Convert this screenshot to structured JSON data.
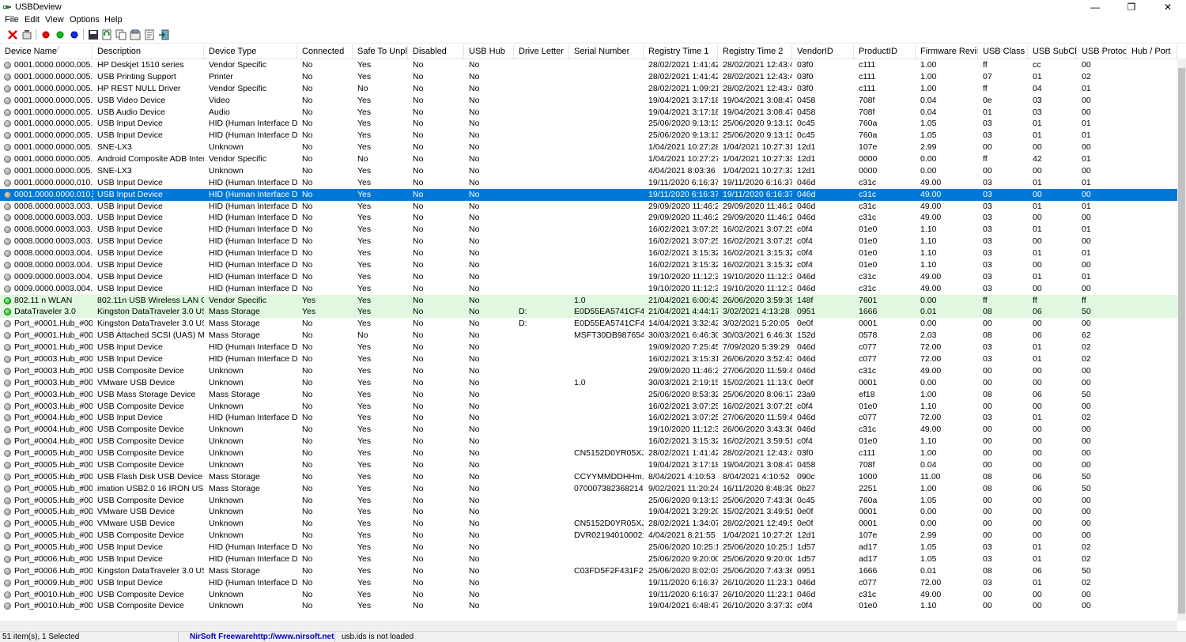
{
  "window": {
    "title": "USBDeview",
    "minimize": "—",
    "restore": "❐",
    "close": "✕"
  },
  "menu": [
    "File",
    "Edit",
    "View",
    "Options",
    "Help"
  ],
  "columns": [
    "Device Name",
    "Description",
    "Device Type",
    "Connected",
    "Safe To Unpl...",
    "Disabled",
    "USB Hub",
    "Drive Letter",
    "Serial Number",
    "Registry Time 1",
    "Registry Time 2",
    "VendorID",
    "ProductID",
    "Firmware Revis...",
    "USB Class",
    "USB SubCl...",
    "USB Protoc...",
    "Hub / Port"
  ],
  "rows": [
    {
      "status": "grey",
      "c": [
        "0001.0000.0000.005.00...",
        "HP Deskjet 1510 series",
        "Vendor Specific",
        "No",
        "Yes",
        "No",
        "No",
        "",
        "",
        "28/02/2021 1:41:42...",
        "28/02/2021 12:43:4...",
        "03f0",
        "c111",
        "1.00",
        "ff",
        "cc",
        "00",
        ""
      ]
    },
    {
      "status": "grey",
      "c": [
        "0001.0000.0000.005.00...",
        "USB Printing Support",
        "Printer",
        "No",
        "Yes",
        "No",
        "No",
        "",
        "",
        "28/02/2021 1:41:42...",
        "28/02/2021 12:43:4...",
        "03f0",
        "c111",
        "1.00",
        "07",
        "01",
        "02",
        ""
      ]
    },
    {
      "status": "grey",
      "c": [
        "0001.0000.0000.005.00...",
        "HP REST NULL Driver",
        "Vendor Specific",
        "No",
        "No",
        "No",
        "No",
        "",
        "",
        "28/02/2021 1:09:21...",
        "28/02/2021 12:43:4...",
        "03f0",
        "c111",
        "1.00",
        "ff",
        "04",
        "01",
        ""
      ]
    },
    {
      "status": "grey",
      "c": [
        "0001.0000.0000.005.00...",
        "USB Video Device",
        "Video",
        "No",
        "Yes",
        "No",
        "No",
        "",
        "",
        "19/04/2021 3:17:18...",
        "19/04/2021 3:08:47...",
        "0458",
        "708f",
        "0.04",
        "0e",
        "03",
        "00",
        ""
      ]
    },
    {
      "status": "grey",
      "c": [
        "0001.0000.0000.005.00...",
        "USB Audio Device",
        "Audio",
        "No",
        "Yes",
        "No",
        "No",
        "",
        "",
        "19/04/2021 3:17:18...",
        "19/04/2021 3:08:47...",
        "0458",
        "708f",
        "0.04",
        "01",
        "03",
        "00",
        ""
      ]
    },
    {
      "status": "grey",
      "c": [
        "0001.0000.0000.005.00...",
        "USB Input Device",
        "HID (Human Interface D...",
        "No",
        "Yes",
        "No",
        "No",
        "",
        "",
        "25/06/2020 9:13:13...",
        "25/06/2020 9:13:13...",
        "0c45",
        "760a",
        "1.05",
        "03",
        "01",
        "01",
        ""
      ]
    },
    {
      "status": "grey",
      "c": [
        "0001.0000.0000.005.00...",
        "USB Input Device",
        "HID (Human Interface D...",
        "No",
        "Yes",
        "No",
        "No",
        "",
        "",
        "25/06/2020 9:13:13...",
        "25/06/2020 9:13:13...",
        "0c45",
        "760a",
        "1.05",
        "03",
        "01",
        "01",
        ""
      ]
    },
    {
      "status": "grey",
      "c": [
        "0001.0000.0000.005.00...",
        "SNE-LX3",
        "Unknown",
        "No",
        "Yes",
        "No",
        "No",
        "",
        "",
        "1/04/2021 10:27:28...",
        "1/04/2021 10:27:31...",
        "12d1",
        "107e",
        "2.99",
        "00",
        "00",
        "00",
        ""
      ]
    },
    {
      "status": "grey",
      "c": [
        "0001.0000.0000.005.00...",
        "Android Composite ADB Inter...",
        "Vendor Specific",
        "No",
        "No",
        "No",
        "No",
        "",
        "",
        "1/04/2021 10:27:27...",
        "1/04/2021 10:27:33...",
        "12d1",
        "0000",
        "0.00",
        "ff",
        "42",
        "01",
        ""
      ]
    },
    {
      "status": "grey",
      "c": [
        "0001.0000.0000.005.00...",
        "SNE-LX3",
        "Unknown",
        "No",
        "Yes",
        "No",
        "No",
        "",
        "",
        "4/04/2021 8:03:36 ...",
        "1/04/2021 10:27:33...",
        "12d1",
        "0000",
        "0.00",
        "00",
        "00",
        "00",
        ""
      ]
    },
    {
      "status": "grey",
      "c": [
        "0001.0000.0000.010.00...",
        "USB Input Device",
        "HID (Human Interface D...",
        "No",
        "Yes",
        "No",
        "No",
        "",
        "",
        "19/11/2020 6:16:37...",
        "19/11/2020 6:16:37...",
        "046d",
        "c31c",
        "49.00",
        "03",
        "01",
        "01",
        ""
      ]
    },
    {
      "status": "grey",
      "selected": true,
      "c": [
        "0001.0000.0000.010.00...",
        "USB Input Device",
        "HID (Human Interface D...",
        "No",
        "Yes",
        "No",
        "No",
        "",
        "",
        "19/11/2020 6:16:37...",
        "19/11/2020 6:16:37...",
        "046d",
        "c31c",
        "49.00",
        "03",
        "00",
        "00",
        ""
      ]
    },
    {
      "status": "grey",
      "c": [
        "0008.0000.0003.003.00...",
        "USB Input Device",
        "HID (Human Interface D...",
        "No",
        "Yes",
        "No",
        "No",
        "",
        "",
        "29/09/2020 11:46:2...",
        "29/09/2020 11:46:2...",
        "046d",
        "c31c",
        "49.00",
        "03",
        "01",
        "01",
        ""
      ]
    },
    {
      "status": "grey",
      "c": [
        "0008.0000.0003.003.00...",
        "USB Input Device",
        "HID (Human Interface D...",
        "No",
        "Yes",
        "No",
        "No",
        "",
        "",
        "29/09/2020 11:46:2...",
        "29/09/2020 11:46:2...",
        "046d",
        "c31c",
        "49.00",
        "03",
        "00",
        "00",
        ""
      ]
    },
    {
      "status": "grey",
      "c": [
        "0008.0000.0003.003.00...",
        "USB Input Device",
        "HID (Human Interface D...",
        "No",
        "Yes",
        "No",
        "No",
        "",
        "",
        "16/02/2021 3:07:25...",
        "16/02/2021 3:07:25...",
        "c0f4",
        "01e0",
        "1.10",
        "03",
        "01",
        "01",
        ""
      ]
    },
    {
      "status": "grey",
      "c": [
        "0008.0000.0003.003.00...",
        "USB Input Device",
        "HID (Human Interface D...",
        "No",
        "Yes",
        "No",
        "No",
        "",
        "",
        "16/02/2021 3:07:25...",
        "16/02/2021 3:07:25...",
        "c0f4",
        "01e0",
        "1.10",
        "03",
        "00",
        "00",
        ""
      ]
    },
    {
      "status": "grey",
      "c": [
        "0008.0000.0003.004.00...",
        "USB Input Device",
        "HID (Human Interface D...",
        "No",
        "Yes",
        "No",
        "No",
        "",
        "",
        "16/02/2021 3:15:32...",
        "16/02/2021 3:15:32...",
        "c0f4",
        "01e0",
        "1.10",
        "03",
        "01",
        "01",
        ""
      ]
    },
    {
      "status": "grey",
      "c": [
        "0008.0000.0003.004.00...",
        "USB Input Device",
        "HID (Human Interface D...",
        "No",
        "Yes",
        "No",
        "No",
        "",
        "",
        "16/02/2021 3:15:32...",
        "16/02/2021 3:15:32...",
        "c0f4",
        "01e0",
        "1.10",
        "03",
        "00",
        "00",
        ""
      ]
    },
    {
      "status": "grey",
      "c": [
        "0009.0000.0003.004.00...",
        "USB Input Device",
        "HID (Human Interface D...",
        "No",
        "Yes",
        "No",
        "No",
        "",
        "",
        "19/10/2020 11:12:3...",
        "19/10/2020 11:12:3...",
        "046d",
        "c31c",
        "49.00",
        "03",
        "01",
        "01",
        ""
      ]
    },
    {
      "status": "grey",
      "c": [
        "0009.0000.0003.004.00...",
        "USB Input Device",
        "HID (Human Interface D...",
        "No",
        "Yes",
        "No",
        "No",
        "",
        "",
        "19/10/2020 11:12:3...",
        "19/10/2020 11:12:3...",
        "046d",
        "c31c",
        "49.00",
        "03",
        "00",
        "00",
        ""
      ]
    },
    {
      "status": "green",
      "green": true,
      "c": [
        "802.11 n WLAN",
        "802.11n USB Wireless LAN Card",
        "Vendor Specific",
        "Yes",
        "Yes",
        "No",
        "No",
        "",
        "1.0",
        "21/04/2021 6:00:43...",
        "26/06/2020 3:59:39...",
        "148f",
        "7601",
        "0.00",
        "ff",
        "ff",
        "ff",
        ""
      ]
    },
    {
      "status": "green",
      "green": true,
      "c": [
        "DataTraveler 3.0",
        "Kingston DataTraveler 3.0 USB ...",
        "Mass Storage",
        "Yes",
        "Yes",
        "No",
        "No",
        "D:",
        "E0D55EA5741CF41...",
        "21/04/2021 4:44:17...",
        "3/02/2021 4:13:28 ...",
        "0951",
        "1666",
        "0.01",
        "08",
        "06",
        "50",
        ""
      ]
    },
    {
      "status": "grey",
      "c": [
        "Port_#0001.Hub_#0001",
        "Kingston DataTraveler 3.0 USB ...",
        "Mass Storage",
        "No",
        "Yes",
        "No",
        "No",
        "D:",
        "E0D55EA5741CF41...",
        "14/04/2021 3:32:42...",
        "3/02/2021 5:20:05 ...",
        "0e0f",
        "0001",
        "0.00",
        "00",
        "00",
        "00",
        ""
      ]
    },
    {
      "status": "grey",
      "c": [
        "Port_#0001.Hub_#0001",
        "USB Attached SCSI (UAS) Mas...",
        "Mass Storage",
        "No",
        "No",
        "No",
        "No",
        "",
        "MSFT30DB9876543...",
        "30/03/2021 6:46:30...",
        "30/03/2021 6:46:30...",
        "152d",
        "0578",
        "2.03",
        "08",
        "06",
        "62",
        ""
      ]
    },
    {
      "status": "grey",
      "c": [
        "Port_#0001.Hub_#0002",
        "USB Input Device",
        "HID (Human Interface D...",
        "No",
        "Yes",
        "No",
        "No",
        "",
        "",
        "19/09/2020 7:25:45...",
        "7/09/2020 5:39:29 ...",
        "046d",
        "c077",
        "72.00",
        "03",
        "01",
        "02",
        ""
      ]
    },
    {
      "status": "grey",
      "c": [
        "Port_#0003.Hub_#0002",
        "USB Input Device",
        "HID (Human Interface D...",
        "No",
        "Yes",
        "No",
        "No",
        "",
        "",
        "16/02/2021 3:15:31...",
        "26/06/2020 3:52:43...",
        "046d",
        "c077",
        "72.00",
        "03",
        "01",
        "02",
        ""
      ]
    },
    {
      "status": "grey",
      "c": [
        "Port_#0003.Hub_#0002",
        "USB Composite Device",
        "Unknown",
        "No",
        "Yes",
        "No",
        "No",
        "",
        "",
        "29/09/2020 11:46:2...",
        "27/06/2020 11:59:4...",
        "046d",
        "c31c",
        "49.00",
        "00",
        "00",
        "00",
        ""
      ]
    },
    {
      "status": "grey",
      "c": [
        "Port_#0003.Hub_#0002",
        "VMware USB Device",
        "Unknown",
        "No",
        "Yes",
        "No",
        "No",
        "",
        "1.0",
        "30/03/2021 2:19:15...",
        "15/02/2021 11:13:0...",
        "0e0f",
        "0001",
        "0.00",
        "00",
        "00",
        "00",
        ""
      ]
    },
    {
      "status": "grey",
      "c": [
        "Port_#0003.Hub_#0002",
        "USB Mass Storage Device",
        "Mass Storage",
        "No",
        "Yes",
        "No",
        "No",
        "",
        "",
        "25/06/2020 8:53:32...",
        "25/06/2020 8:06:17...",
        "23a9",
        "ef18",
        "1.00",
        "08",
        "06",
        "50",
        ""
      ]
    },
    {
      "status": "grey",
      "c": [
        "Port_#0003.Hub_#0002",
        "USB Composite Device",
        "Unknown",
        "No",
        "Yes",
        "No",
        "No",
        "",
        "",
        "16/02/2021 3:07:25...",
        "16/02/2021 3:07:25...",
        "c0f4",
        "01e0",
        "1.10",
        "00",
        "00",
        "00",
        ""
      ]
    },
    {
      "status": "grey",
      "c": [
        "Port_#0004.Hub_#0002",
        "USB Input Device",
        "HID (Human Interface D...",
        "No",
        "Yes",
        "No",
        "No",
        "",
        "",
        "16/02/2021 3:07:25...",
        "27/06/2020 11:59:4...",
        "046d",
        "c077",
        "72.00",
        "03",
        "01",
        "02",
        ""
      ]
    },
    {
      "status": "grey",
      "c": [
        "Port_#0004.Hub_#0002",
        "USB Composite Device",
        "Unknown",
        "No",
        "Yes",
        "No",
        "No",
        "",
        "",
        "19/10/2020 11:12:3...",
        "26/06/2020 3:43:36...",
        "046d",
        "c31c",
        "49.00",
        "00",
        "00",
        "00",
        ""
      ]
    },
    {
      "status": "grey",
      "c": [
        "Port_#0004.Hub_#0002",
        "USB Composite Device",
        "Unknown",
        "No",
        "Yes",
        "No",
        "No",
        "",
        "",
        "16/02/2021 3:15:32...",
        "16/02/2021 3:59:51...",
        "c0f4",
        "01e0",
        "1.10",
        "00",
        "00",
        "00",
        ""
      ]
    },
    {
      "status": "grey",
      "c": [
        "Port_#0005.Hub_#0001",
        "USB Composite Device",
        "Unknown",
        "No",
        "Yes",
        "No",
        "No",
        "",
        "CN5152D0YR05XJ",
        "28/02/2021 1:41:42...",
        "28/02/2021 12:43:4...",
        "03f0",
        "c111",
        "1.00",
        "00",
        "00",
        "00",
        ""
      ]
    },
    {
      "status": "grey",
      "c": [
        "Port_#0005.Hub_#0001",
        "USB Composite Device",
        "Unknown",
        "No",
        "Yes",
        "No",
        "No",
        "",
        "",
        "19/04/2021 3:17:18...",
        "19/04/2021 3:08:47...",
        "0458",
        "708f",
        "0.04",
        "00",
        "00",
        "00",
        ""
      ]
    },
    {
      "status": "grey",
      "c": [
        "Port_#0005.Hub_#0001",
        "USB Flash Disk USB Device",
        "Mass Storage",
        "No",
        "Yes",
        "No",
        "No",
        "",
        "CCYYMMDDHHm...",
        "8/04/2021 4:10:53 ...",
        "8/04/2021 4:10:52 ...",
        "090c",
        "1000",
        "11.00",
        "08",
        "06",
        "50",
        ""
      ]
    },
    {
      "status": "grey",
      "c": [
        "Port_#0005.Hub_#0001",
        "imation USB2.0 16 IRON USB ...",
        "Mass Storage",
        "No",
        "Yes",
        "No",
        "No",
        "",
        "070007382368214B",
        "9/02/2021 11:20:24...",
        "16/11/2020 8:48:39...",
        "0b27",
        "2251",
        "1.00",
        "08",
        "06",
        "50",
        ""
      ]
    },
    {
      "status": "grey",
      "c": [
        "Port_#0005.Hub_#0001",
        "USB Composite Device",
        "Unknown",
        "No",
        "Yes",
        "No",
        "No",
        "",
        "",
        "25/06/2020 9:13:13...",
        "25/06/2020 7:43:36...",
        "0c45",
        "760a",
        "1.05",
        "00",
        "00",
        "00",
        ""
      ]
    },
    {
      "status": "grey",
      "c": [
        "Port_#0005.Hub_#0001",
        "VMware USB Device",
        "Unknown",
        "No",
        "Yes",
        "No",
        "No",
        "",
        "",
        "19/04/2021 3:29:20...",
        "15/02/2021 3:49:51...",
        "0e0f",
        "0001",
        "0.00",
        "00",
        "00",
        "00",
        ""
      ]
    },
    {
      "status": "grey",
      "c": [
        "Port_#0005.Hub_#0001",
        "VMware USB Device",
        "Unknown",
        "No",
        "Yes",
        "No",
        "No",
        "",
        "CN5152D0YR05XJ",
        "28/02/2021 1:34:07...",
        "28/02/2021 12:49:5...",
        "0e0f",
        "0001",
        "0.00",
        "00",
        "00",
        "00",
        ""
      ]
    },
    {
      "status": "grey",
      "c": [
        "Port_#0005.Hub_#0001",
        "USB Composite Device",
        "Unknown",
        "No",
        "Yes",
        "No",
        "No",
        "",
        "DVR0219401000212",
        "4/04/2021 8:21:55 ...",
        "1/04/2021 10:27:20...",
        "12d1",
        "107e",
        "2.99",
        "00",
        "00",
        "00",
        ""
      ]
    },
    {
      "status": "grey",
      "c": [
        "Port_#0005.Hub_#0001",
        "USB Input Device",
        "HID (Human Interface D...",
        "No",
        "Yes",
        "No",
        "No",
        "",
        "",
        "25/06/2020 10:25:1...",
        "25/06/2020 10:25:1...",
        "1d57",
        "ad17",
        "1.05",
        "03",
        "01",
        "02",
        ""
      ]
    },
    {
      "status": "grey",
      "c": [
        "Port_#0006.Hub_#0001",
        "USB Input Device",
        "HID (Human Interface D...",
        "No",
        "Yes",
        "No",
        "No",
        "",
        "",
        "25/06/2020 9:20:00...",
        "25/06/2020 9:20:00...",
        "1d57",
        "ad17",
        "1.05",
        "03",
        "01",
        "02",
        ""
      ]
    },
    {
      "status": "grey",
      "c": [
        "Port_#0006.Hub_#0002",
        "Kingston DataTraveler 3.0 USB ...",
        "Mass Storage",
        "No",
        "Yes",
        "No",
        "No",
        "",
        "C03FD5F2F431F26...",
        "25/06/2020 8:02:03...",
        "25/06/2020 7:43:36...",
        "0951",
        "1666",
        "0.01",
        "08",
        "06",
        "50",
        ""
      ]
    },
    {
      "status": "grey",
      "c": [
        "Port_#0009.Hub_#0001",
        "USB Input Device",
        "HID (Human Interface D...",
        "No",
        "Yes",
        "No",
        "No",
        "",
        "",
        "19/11/2020 6:16:37...",
        "26/10/2020 11:23:1...",
        "046d",
        "c077",
        "72.00",
        "03",
        "01",
        "02",
        ""
      ]
    },
    {
      "status": "grey",
      "c": [
        "Port_#0010.Hub_#0001",
        "USB Composite Device",
        "Unknown",
        "No",
        "Yes",
        "No",
        "No",
        "",
        "",
        "19/11/2020 6:16:37...",
        "26/10/2020 11:23:1...",
        "046d",
        "c31c",
        "49.00",
        "00",
        "00",
        "00",
        ""
      ]
    },
    {
      "status": "grey",
      "c": [
        "Port_#0010.Hub_#0001",
        "USB Composite Device",
        "Unknown",
        "No",
        "Yes",
        "No",
        "No",
        "",
        "",
        "19/04/2021 6:48:47...",
        "26/10/2020 3:37:33...",
        "c0f4",
        "01e0",
        "1.10",
        "00",
        "00",
        "00",
        ""
      ]
    }
  ],
  "status": {
    "count": "51 item(s), 1 Selected",
    "freeware_label": "NirSoft Freeware.",
    "url": "http://www.nirsoft.net",
    "usbids": "usb.ids is not loaded"
  },
  "colors": {
    "selected": "#0078d7",
    "connected_row": "#e0f8e0"
  }
}
